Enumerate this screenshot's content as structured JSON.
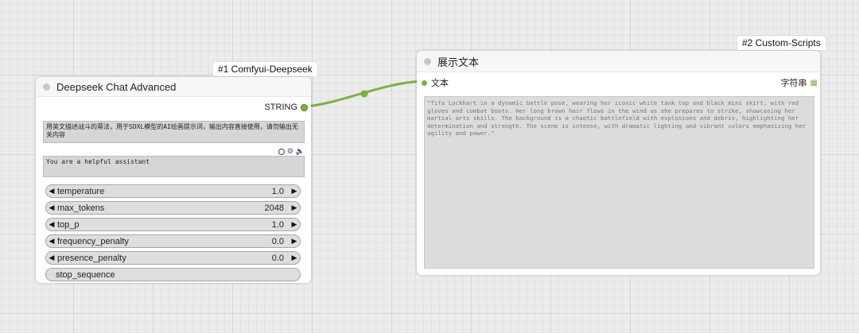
{
  "node1": {
    "badge": "#1 Comfyui-Deepseek",
    "title": "Deepseek Chat Advanced",
    "output_label": "STRING",
    "prompt_text": "用英文描述战斗的蒂法，用于SDXL模型的AI绘画提示词，输出内容直接使用，请勿输出无关内容",
    "system_text": "You are a helpful assistant",
    "widgets": [
      {
        "label": "temperature",
        "value": "1.0"
      },
      {
        "label": "max_tokens",
        "value": "2048"
      },
      {
        "label": "top_p",
        "value": "1.0"
      },
      {
        "label": "frequency_penalty",
        "value": "0.0"
      },
      {
        "label": "presence_penalty",
        "value": "0.0"
      }
    ],
    "stop_sequence_label": "stop_sequence",
    "icons": [
      "circle-icon",
      "gear-icon",
      "speaker-icon"
    ]
  },
  "node2": {
    "badge": "#2 Custom-Scripts",
    "title": "展示文本",
    "input_label": "文本",
    "type_label": "字符串",
    "display_text": "\"Tifa Lockhart in a dynamic battle pose, wearing her iconic white tank top and black mini skirt, with red gloves and combat boots. Her long brown hair flows in the wind as she prepares to strike, showcasing her martial arts skills. The background is a chaotic battlefield with explosions and debris, highlighting her determination and strength. The scene is intense, with dramatic lighting and vibrant colors emphasizing her agility and power.\""
  },
  "colors": {
    "link": "#7ab33b",
    "accent_green": "#7ab33b"
  }
}
